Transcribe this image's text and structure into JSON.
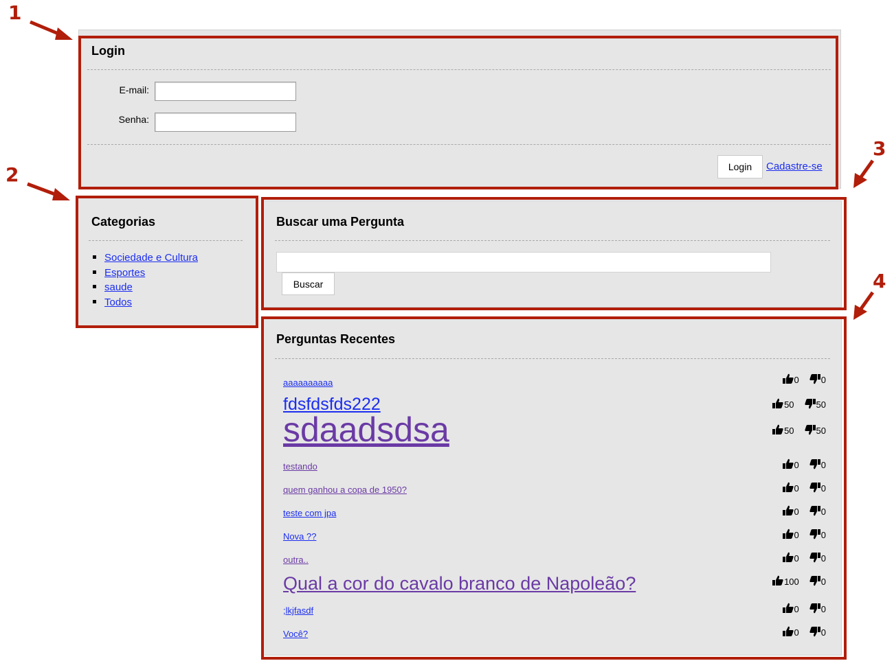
{
  "callouts": [
    "1",
    "2",
    "3",
    "4"
  ],
  "login": {
    "title": "Login",
    "email_label": "E-mail:",
    "password_label": "Senha:",
    "email_value": "",
    "password_value": "",
    "login_button": "Login",
    "register_link": "Cadastre-se"
  },
  "categories": {
    "title": "Categorias",
    "items": [
      "Sociedade e Cultura",
      "Esportes",
      "saude",
      "Todos"
    ]
  },
  "search": {
    "title": "Buscar uma Pergunta",
    "query_value": "",
    "button": "Buscar"
  },
  "recent": {
    "title": "Perguntas Recentes",
    "questions": [
      {
        "text": "aaaaaaaaaa",
        "up": "0",
        "down": "0"
      },
      {
        "text": "fdsfdsfds222",
        "up": "50",
        "down": "50"
      },
      {
        "text": "sdaadsdsa",
        "up": "50",
        "down": "50"
      },
      {
        "text": "testando",
        "up": "0",
        "down": "0"
      },
      {
        "text": "quem ganhou a copa de 1950?",
        "up": "0",
        "down": "0"
      },
      {
        "text": "teste com jpa",
        "up": "0",
        "down": "0"
      },
      {
        "text": "Nova ??",
        "up": "0",
        "down": "0"
      },
      {
        "text": "outra..",
        "up": "0",
        "down": "0"
      },
      {
        "text": "Qual a cor do cavalo branco de Napoleão?",
        "up": "100",
        "down": "0"
      },
      {
        "text": ";lkjfasdf",
        "up": "0",
        "down": "0"
      },
      {
        "text": "Você?",
        "up": "0",
        "down": "0"
      }
    ]
  },
  "colors": {
    "frame": "#b11e0a",
    "panel": "#e6e6e6",
    "link": "#1b2df0",
    "visited": "#6a3aa5"
  },
  "icons": {
    "vote_up": "thumbs-up-icon",
    "vote_down": "thumbs-down-icon"
  }
}
